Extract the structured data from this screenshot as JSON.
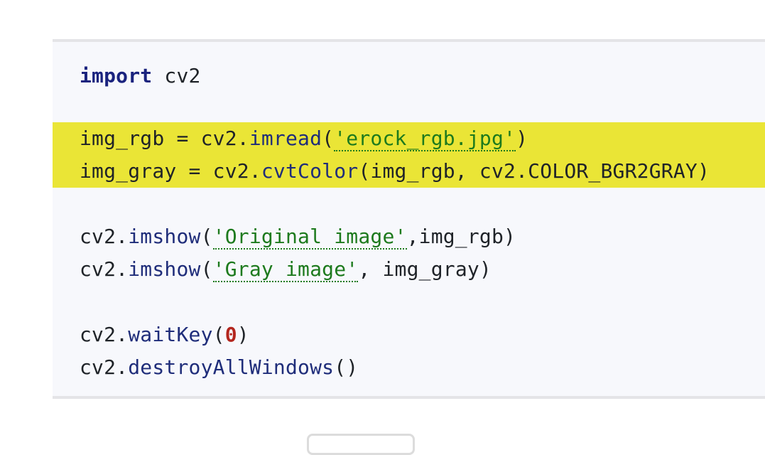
{
  "code": {
    "line1": {
      "keyword": "import",
      "rest": " cv2"
    },
    "line2": {
      "var": "img_rgb = cv2.",
      "fn": "imread",
      "open": "(",
      "str": "'erock_rgb.jpg'",
      "close": ")"
    },
    "line3": {
      "var": "img_gray = cv2.",
      "fn": "cvtColor",
      "rest": "(img_rgb, cv2.COLOR_BGR2GRAY)"
    },
    "line4": {
      "prefix": "cv2.",
      "fn": "imshow",
      "open": "(",
      "str": "'Original image'",
      "rest": ",img_rgb)"
    },
    "line5": {
      "prefix": "cv2.",
      "fn": "imshow",
      "open": "(",
      "str": "'Gray image'",
      "rest": ", img_gray)"
    },
    "line6": {
      "prefix": "cv2.",
      "fn": "waitKey",
      "open": "(",
      "num": "0",
      "close": ")"
    },
    "line7": {
      "prefix": "cv2.",
      "fn": "destroyAllWindows",
      "rest": "()"
    }
  },
  "colors": {
    "highlight": "#eae536",
    "keyword": "#1a237e",
    "string": "#1d7a1d",
    "number": "#b3261e",
    "background": "#f7f8fc"
  }
}
